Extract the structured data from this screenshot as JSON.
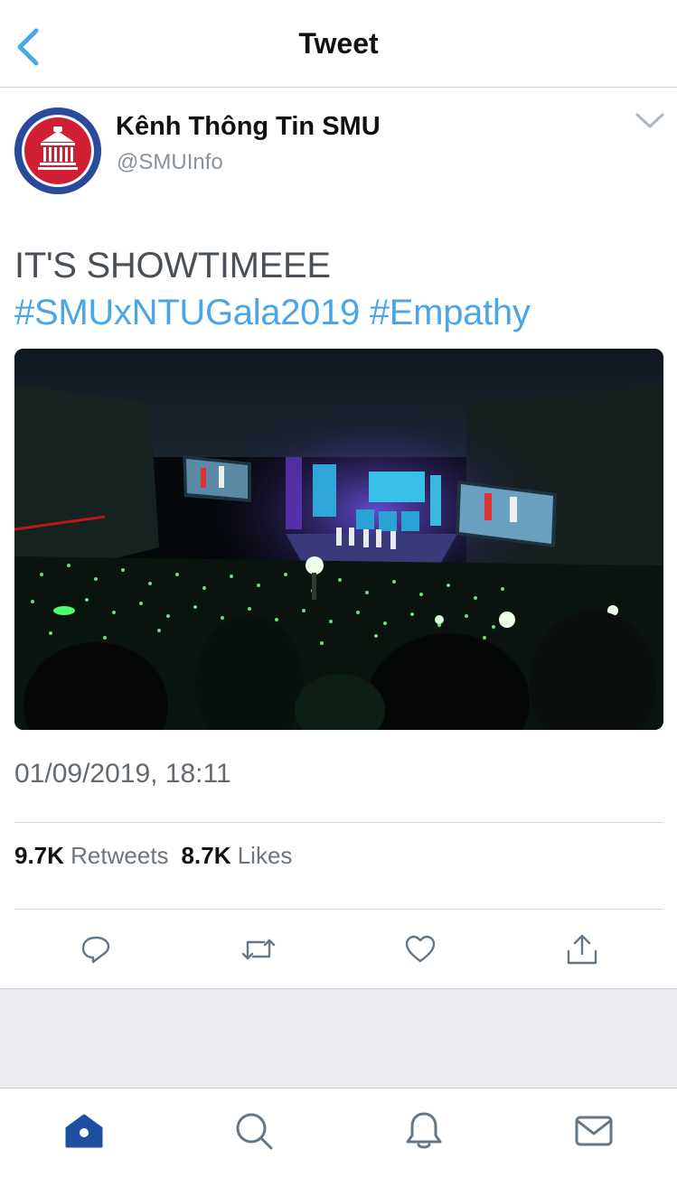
{
  "nav": {
    "title": "Tweet",
    "back_icon": "chevron-left-icon"
  },
  "tweet": {
    "author_name": "Kênh Thông Tin SMU",
    "author_handle": "@SMUInfo",
    "text": "IT'S SHOWTIMEEE",
    "hashtags": [
      "#SMUxNTUGala2019",
      "#Empathy"
    ],
    "timestamp": "01/09/2019, 18:11",
    "retweets_count": "9.7K",
    "retweets_label": "Retweets",
    "likes_count": "8.7K",
    "likes_label": "Likes"
  },
  "actions": [
    "reply-icon",
    "retweet-icon",
    "like-icon",
    "share-icon"
  ],
  "tabs": [
    "home-icon",
    "search-icon",
    "notifications-icon",
    "messages-icon"
  ],
  "colors": {
    "accent": "#4aa6e5",
    "tab_active": "#1f4fa0",
    "icon_gray": "#657786",
    "avatar_ring": "#2a4a9b",
    "avatar_red": "#d01f33"
  }
}
